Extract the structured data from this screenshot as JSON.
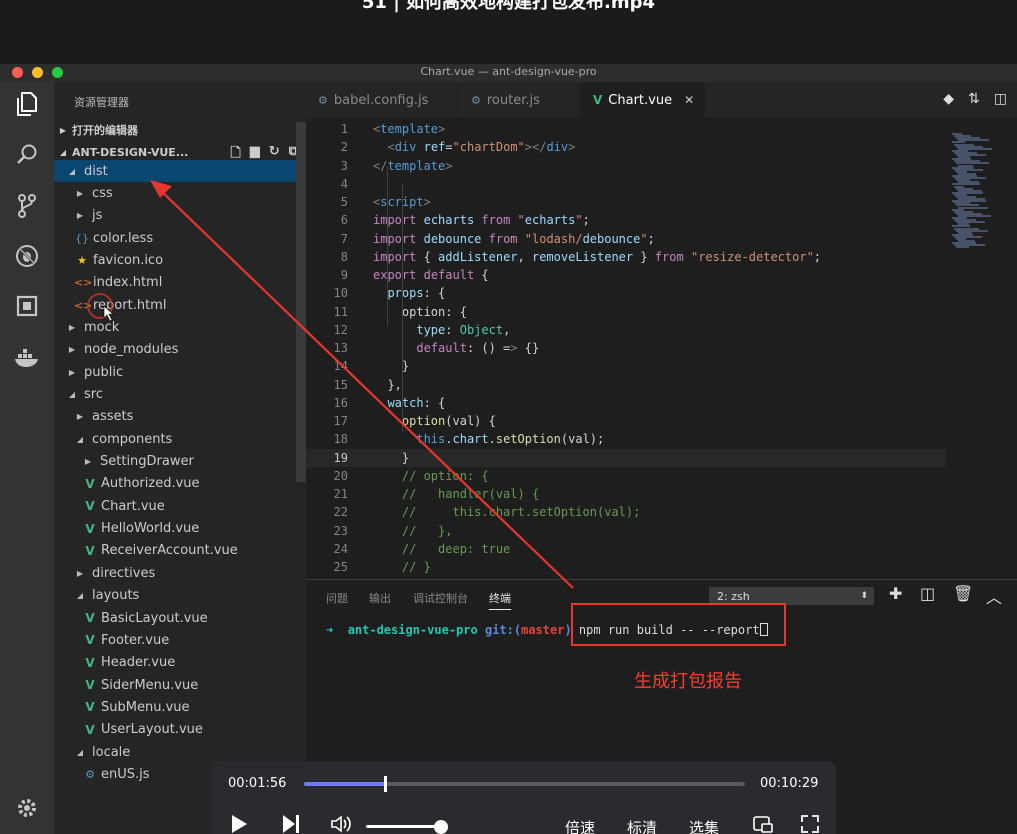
{
  "video_title": "51 | 如何高效地构建打包发布.mp4",
  "window_title": "Chart.vue — ant-design-vue-pro",
  "sidebar": {
    "title": "资源管理器",
    "open_editors": "打开的编辑器",
    "project": "ANT-DESIGN-VUE...",
    "tree": [
      {
        "label": "dist",
        "icon": "folder-open",
        "expanded": true,
        "selected": true
      },
      {
        "label": "css",
        "icon": "folder-closed"
      },
      {
        "label": "js",
        "icon": "folder-closed"
      },
      {
        "label": "color.less",
        "icon": "less-file-icon"
      },
      {
        "label": "favicon.ico",
        "icon": "star-file-icon"
      },
      {
        "label": "index.html",
        "icon": "html-file-icon"
      },
      {
        "label": "report.html",
        "icon": "html-file-icon"
      },
      {
        "label": "mock",
        "icon": "folder-closed"
      },
      {
        "label": "node_modules",
        "icon": "folder-closed"
      },
      {
        "label": "public",
        "icon": "folder-closed"
      },
      {
        "label": "src",
        "icon": "folder-open"
      },
      {
        "label": "assets",
        "icon": "folder-closed"
      },
      {
        "label": "components",
        "icon": "folder-open"
      },
      {
        "label": "SettingDrawer",
        "icon": "folder-closed"
      },
      {
        "label": "Authorized.vue",
        "icon": "vue-file-icon"
      },
      {
        "label": "Chart.vue",
        "icon": "vue-file-icon"
      },
      {
        "label": "HelloWorld.vue",
        "icon": "vue-file-icon"
      },
      {
        "label": "ReceiverAccount.vue",
        "icon": "vue-file-icon"
      },
      {
        "label": "directives",
        "icon": "folder-closed"
      },
      {
        "label": "layouts",
        "icon": "folder-open"
      },
      {
        "label": "BasicLayout.vue",
        "icon": "vue-file-icon"
      },
      {
        "label": "Footer.vue",
        "icon": "vue-file-icon"
      },
      {
        "label": "Header.vue",
        "icon": "vue-file-icon"
      },
      {
        "label": "SiderMenu.vue",
        "icon": "vue-file-icon"
      },
      {
        "label": "SubMenu.vue",
        "icon": "vue-file-icon"
      },
      {
        "label": "UserLayout.vue",
        "icon": "vue-file-icon"
      },
      {
        "label": "locale",
        "icon": "folder-open"
      },
      {
        "label": "enUS.js",
        "icon": "js-file-icon"
      }
    ]
  },
  "tabs": [
    {
      "label": "babel.config.js",
      "icon": "babel-icon"
    },
    {
      "label": "router.js",
      "icon": "js-file-icon"
    },
    {
      "label": "Chart.vue",
      "icon": "vue-file-icon",
      "active": true
    }
  ],
  "code_lines": [
    {
      "n": "1",
      "t": "<template>"
    },
    {
      "n": "2",
      "t": "  <div ref=\"chartDom\"></div>"
    },
    {
      "n": "3",
      "t": "</template>"
    },
    {
      "n": "4",
      "t": ""
    },
    {
      "n": "5",
      "t": "<script>"
    },
    {
      "n": "6",
      "t": "import echarts from \"echarts\";"
    },
    {
      "n": "7",
      "t": "import debounce from \"lodash/debounce\";"
    },
    {
      "n": "8",
      "t": "import { addListener, removeListener } from \"resize-detector\";"
    },
    {
      "n": "9",
      "t": "export default {"
    },
    {
      "n": "10",
      "t": "  props: {"
    },
    {
      "n": "11",
      "t": "    option: {"
    },
    {
      "n": "12",
      "t": "      type: Object,"
    },
    {
      "n": "13",
      "t": "      default: () => {}"
    },
    {
      "n": "14",
      "t": "    }"
    },
    {
      "n": "15",
      "t": "  },"
    },
    {
      "n": "16",
      "t": "  watch: {"
    },
    {
      "n": "17",
      "t": "    option(val) {"
    },
    {
      "n": "18",
      "t": "      this.chart.setOption(val);"
    },
    {
      "n": "19",
      "t": "    }"
    },
    {
      "n": "20",
      "t": "    // option: {"
    },
    {
      "n": "21",
      "t": "    //   handler(val) {"
    },
    {
      "n": "22",
      "t": "    //     this.chart.setOption(val);"
    },
    {
      "n": "23",
      "t": "    //   },"
    },
    {
      "n": "24",
      "t": "    //   deep: true"
    },
    {
      "n": "25",
      "t": "    // }"
    }
  ],
  "current_line": "19",
  "panel": {
    "tabs": [
      "问题",
      "输出",
      "调试控制台",
      "终端"
    ],
    "active_tab": "终端",
    "terminal_select": "2: zsh",
    "terminal": {
      "arrow": "➜",
      "dir": "ant-design-vue-pro",
      "git": "git:(",
      "branch": "master",
      "git_end": ")",
      "command": "npm run build -- --report"
    }
  },
  "annotation": "生成打包报告",
  "player": {
    "current_time": "00:01:56",
    "total_time": "00:10:29",
    "progress": 0.184,
    "volume": 0.9,
    "speed": "倍速",
    "quality": "标清",
    "episodes": "选集"
  }
}
